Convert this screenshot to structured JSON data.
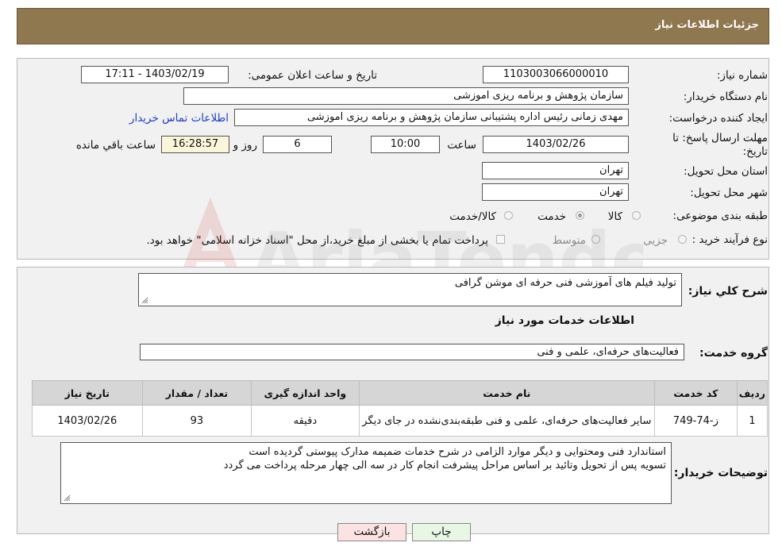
{
  "header": {
    "title": "جزئیات اطلاعات نیاز"
  },
  "details": {
    "need_number_label": "شماره نیاز:",
    "need_number": "1103003066000010",
    "announce_label": "تاریخ و ساعت اعلان عمومی:",
    "announce_value": "1403/02/19 - 17:11",
    "buyer_org_label": "نام دستگاه خریدار:",
    "buyer_org": "سازمان پژوهش و برنامه ریزی اموزشی",
    "creator_label": "ایجاد کننده درخواست:",
    "creator": "مهدی زمانی رئیس اداره پشتیبانی سازمان پژوهش و برنامه ریزی اموزشی",
    "contact_link": "اطلاعات تماس خریدار",
    "deadline_label": "مهلت ارسال پاسخ: تا تاریخ:",
    "deadline_date": "1403/02/26",
    "time_label": "ساعت",
    "deadline_time": "10:00",
    "days_value": "6",
    "days_label": "روز و",
    "remaining_value": "16:28:57",
    "remaining_label": "ساعت باقي مانده",
    "province_label": "استان محل تحویل:",
    "province": "تهران",
    "city_label": "شهر محل تحویل:",
    "city": "تهران",
    "category_label": "طبقه بندی موضوعی:",
    "category_options": [
      "کالا",
      "خدمت",
      "کالا/خدمت"
    ],
    "category_selected": "خدمت",
    "process_label": "نوع فرآیند خرید :",
    "process_options": [
      "جزیی",
      "متوسط"
    ],
    "process_note": "پرداخت تمام یا بخشی از مبلغ خرید،از محل \"اسناد خزانه اسلامی\" خواهد بود."
  },
  "description": {
    "general_label": "شرح کلي نياز:",
    "general_value": "تولید فیلم های آموزشی فنی حرفه ای موشن گرافی",
    "services_title": "اطلاعات خدمات مورد نياز",
    "group_label": "گروه خدمت:",
    "group_value": "فعالیت‌های حرفه‌ای، علمی و فنی"
  },
  "table": {
    "headers": [
      "ردیف",
      "کد خدمت",
      "نام خدمت",
      "واحد اندازه گیری",
      "تعداد / مقدار",
      "تاریخ نیاز"
    ],
    "rows": [
      [
        "1",
        "ز-74-749",
        "سایر فعالیت‌های حرفه‌ای، علمی و فنی طبقه‌بندی‌نشده در جای دیگر",
        "دقیقه",
        "93",
        "1403/02/26"
      ]
    ]
  },
  "notes": {
    "label": "توضیحات خریدار:",
    "line1": "استاندارد فنی ومحتوایی و دیگر موارد الزامی در شرح خدمات ضمیمه مدارک پیوستی گردیده است",
    "line2": "تسویه پس از تحویل وتائید بر اساس مراحل پیشرفت انجام کار در سه الی چهار مرحله پرداخت می گردد"
  },
  "buttons": {
    "print": "چاپ",
    "back": "بازگشت"
  },
  "watermark": {
    "text": "AriaTender.neT"
  },
  "colors": {
    "header_bg": "#8f7750",
    "link": "#1a3ecf",
    "print_btn": "#e7f7e4",
    "back_btn": "#fbe3e3"
  }
}
